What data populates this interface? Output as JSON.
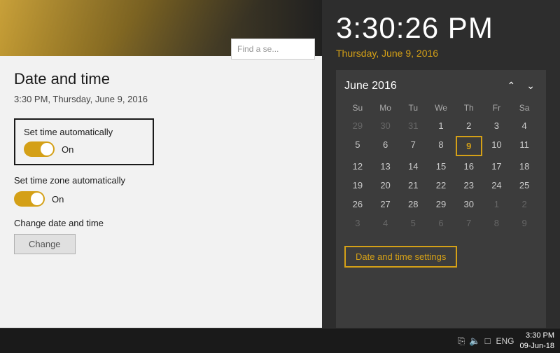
{
  "settings": {
    "title": "Date and time",
    "current_time": "3:30 PM, Thursday, June 9, 2016",
    "set_time_auto": {
      "label": "Set time automatically",
      "state": "On"
    },
    "set_zone_auto": {
      "label": "Set time zone automatically",
      "state": "On"
    },
    "change_section": {
      "label": "Change date and time",
      "button": "Change"
    },
    "search_placeholder": "Find a se..."
  },
  "clock": {
    "time": "3:30:26 PM",
    "date": "Thursday, June 9, 2016",
    "calendar": {
      "month_year": "June 2016",
      "day_headers": [
        "Su",
        "Mo",
        "Tu",
        "We",
        "Th",
        "Fr",
        "Sa"
      ],
      "rows": [
        [
          "29",
          "30",
          "31",
          "1",
          "2",
          "3",
          "4"
        ],
        [
          "5",
          "6",
          "7",
          "8",
          "9",
          "10",
          "11"
        ],
        [
          "12",
          "13",
          "14",
          "15",
          "16",
          "17",
          "18"
        ],
        [
          "19",
          "20",
          "21",
          "22",
          "23",
          "24",
          "25"
        ],
        [
          "26",
          "27",
          "28",
          "29",
          "30",
          "1",
          "2"
        ],
        [
          "3",
          "4",
          "5",
          "6",
          "7",
          "8",
          "9"
        ]
      ],
      "today_row": 1,
      "today_col": 4
    },
    "settings_button": "Date and time settings"
  },
  "taskbar": {
    "lang": "ENG",
    "time": "3:30 PM",
    "date": "09-Jun-18"
  }
}
